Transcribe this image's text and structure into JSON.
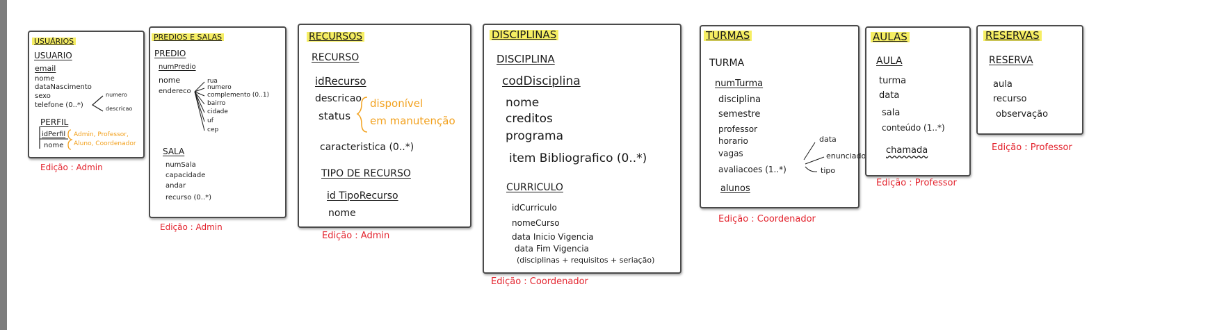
{
  "colors": {
    "highlight": "#f6ee63",
    "edition_text": "#e3232d",
    "annotation_text": "#f2a11e",
    "ink": "#1a1a1a",
    "frame": "#4a4a4a"
  },
  "usuarios": {
    "title": "USUÁRIOS",
    "entity": "USUARIO",
    "fields": [
      "email",
      "nome",
      "dataNascimento",
      "sexo",
      "telefone (0..*)"
    ],
    "phone_parts": [
      "numero",
      "descricao"
    ],
    "sub_entity": "PERFIL",
    "sub_fields": [
      "idPerfil",
      "nome"
    ],
    "roles": [
      "Admin, Professor,",
      "Aluno, Coordenador"
    ],
    "edition": "Edição : Admin"
  },
  "predios": {
    "title": "PREDIOS E SALAS",
    "entity": "PREDIO",
    "fields": [
      "numPredio",
      "nome",
      "endereco"
    ],
    "address_parts": [
      "rua",
      "numero",
      "complemento (0..1)",
      "bairro",
      "cidade",
      "uf",
      "cep"
    ],
    "sub_entity": "SALA",
    "sub_fields": [
      "numSala",
      "capacidade",
      "andar",
      "recurso (0..*)"
    ],
    "edition": "Edição : Admin"
  },
  "recursos": {
    "title": "RECURSOS",
    "entity": "RECURSO",
    "fields": [
      "idRecurso",
      "descricao",
      "status",
      "caracteristica (0..*)"
    ],
    "status_values": [
      "disponível",
      "em manutenção"
    ],
    "sub_entity": "TIPO DE RECURSO",
    "sub_fields": [
      "id TipoRecurso",
      "nome"
    ],
    "edition": "Edição : Admin"
  },
  "disciplinas": {
    "title": "DISCIPLINAS",
    "entity": "DISCIPLINA",
    "fields": [
      "codDisciplina",
      "nome",
      "creditos",
      "programa",
      "item Bibliografico (0..*)"
    ],
    "sub_entity": "CURRICULO",
    "sub_fields": [
      "idCurriculo",
      "nomeCurso",
      "data Inicio Vigencia",
      "data Fim Vigencia",
      "(disciplinas + requisitos + seriação)"
    ],
    "edition": "Edição : Coordenador"
  },
  "turmas": {
    "title": "TURMAS",
    "entity": "TURMA",
    "fields": [
      "numTurma",
      "disciplina",
      "semestre",
      "professor",
      "horario",
      "vagas",
      "avaliacoes (1..*)",
      "alunos"
    ],
    "eval_parts": [
      "data",
      "enunciado",
      "tipo"
    ],
    "edition": "Edição : Coordenador"
  },
  "aulas": {
    "title": "AULAS",
    "entity": "AULA",
    "fields": [
      "turma",
      "data",
      "sala",
      "conteúdo (1..*)",
      "chamada"
    ],
    "edition": "Edição : Professor"
  },
  "reservas": {
    "title": "RESERVAS",
    "entity": "RESERVA",
    "fields": [
      "aula",
      "recurso",
      "observação"
    ],
    "edition": "Edição : Professor"
  }
}
